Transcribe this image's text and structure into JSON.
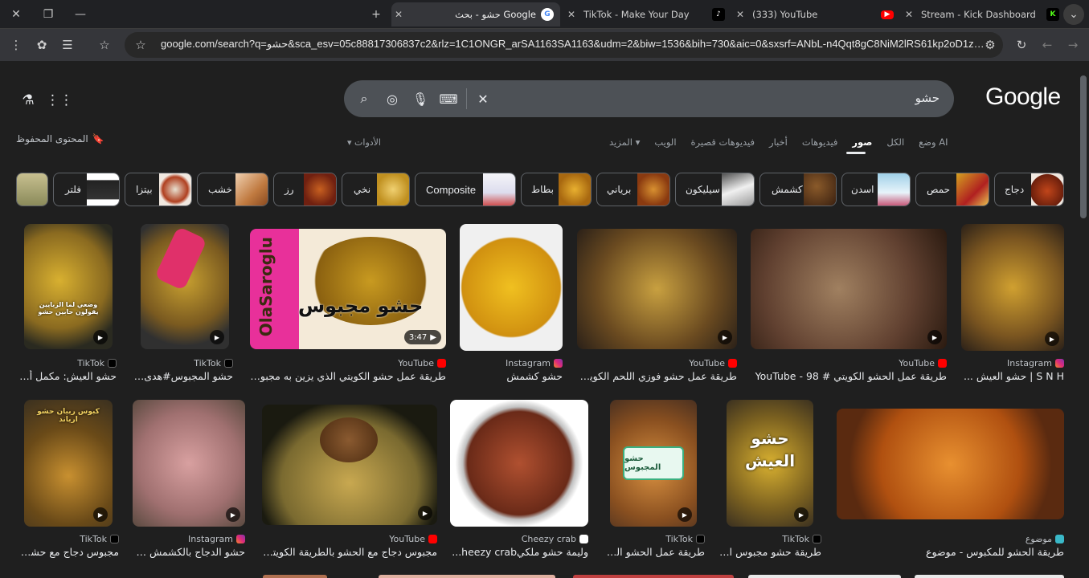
{
  "browser": {
    "tabs": [
      {
        "title": "حشو - بحث Google",
        "icon": "google-icon",
        "active": true
      },
      {
        "title": "TikTok - Make Your Day",
        "icon": "tiktok-icon",
        "active": false
      },
      {
        "title": "(333) YouTube",
        "icon": "youtube-icon",
        "active": false
      },
      {
        "title": "Stream - Kick Dashboard",
        "icon": "kick-icon",
        "active": false
      }
    ],
    "url": "google.com/search?q=حشو&sca_esv=05c88817306837c2&rlz=1C1ONGR_arSA1163SA1163&udm=2&biw=1536&bih=730&aic=0&sxsrf=ANbL-n4Qqt8gC8NiM2lRS61kp2oD1zNQ4w%3..."
  },
  "search": {
    "query": "حشو",
    "logo": "Google"
  },
  "header": {
    "saved_label": "المحتوى المحفوظ",
    "tools_label": "الأدوات"
  },
  "nav_tabs": [
    "وضع AI",
    "الكل",
    "صور",
    "فيديوهات",
    "أخبار",
    "فيديوهات قصيرة",
    "الويب",
    "المزيد"
  ],
  "chips": [
    "دجاج",
    "حمص",
    "اسدن",
    "كشمش",
    "سيليكون",
    "برياني",
    "بطاط",
    "Composite",
    "نخي",
    "رز",
    "خشب",
    "بيتزا",
    "فلتر"
  ],
  "results_row1": [
    {
      "source": "TikTok",
      "title": "حشو العيش: مكمل أسا..."
    },
    {
      "source": "TikTok",
      "title": "حشو المجبوس#هدى_ال..."
    },
    {
      "source": "YouTube",
      "title": "طريقة عمل حشو الكويتي الذي يزين به مجبوس ال...",
      "duration": "3:47",
      "overlay": "حشو مجبوس",
      "side": "OlaSaroglu"
    },
    {
      "source": "Instagram",
      "title": "حشو كشمش"
    },
    {
      "source": "YouTube",
      "title": "طريقة عمل حشو فوزي اللحم الكويتي -..."
    },
    {
      "source": "YouTube",
      "title": "طريقة عمل الحشو الكويتي # 98 - YouTube"
    },
    {
      "source": "Instagram",
      "title": "S N H | حشو العيش ..."
    }
  ],
  "results_row2": [
    {
      "source": "TikTok",
      "title": "مجبوس دجاج مع حشو ..."
    },
    {
      "source": "Instagram",
      "title": "حشو الدجاج بالكشمش والد..."
    },
    {
      "source": "YouTube",
      "title": "مجبوس دجاج مع الحشو بالطريقة الكويتية..."
    },
    {
      "source": "Cheezy crab",
      "title": "وليمة حشو ملكيheezy crab..."
    },
    {
      "source": "TikTok",
      "title": "طريقة عمل الحشو الكو...",
      "overlay": "حشو المجبوس"
    },
    {
      "source": "TikTok",
      "title": "طريقة حشو مجبوس الد...",
      "overlay": "حشو العيش"
    },
    {
      "source": "موضوع",
      "title": "طريقة الحشو للمكبوس - موضوع"
    }
  ],
  "overlays": {
    "r1_0": "وضعي لما الزبايين يقولون حابين حشو",
    "r2_0": "كبوس ربيان حشو ارباند"
  },
  "colors": {
    "page_bg": "#1f1f1f",
    "accent": "#e8eaed"
  }
}
